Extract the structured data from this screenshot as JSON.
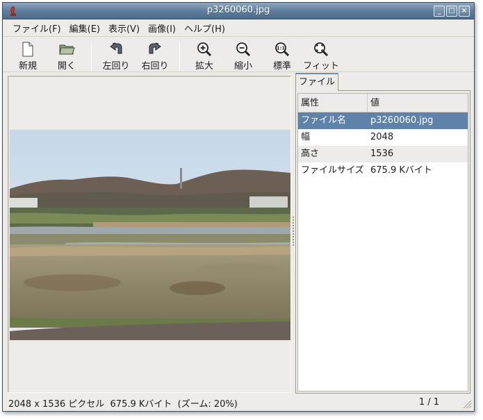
{
  "window": {
    "title": "p3260060.jpg",
    "controls": [
      "_",
      "□",
      "×"
    ]
  },
  "menu": [
    {
      "label": "ファイル(F)"
    },
    {
      "label": "編集(E)"
    },
    {
      "label": "表示(V)"
    },
    {
      "label": "画像(I)"
    },
    {
      "label": "ヘルプ(H)"
    }
  ],
  "toolbar": {
    "new_label": "新規",
    "open_label": "開く",
    "rotate_left_label": "左回り",
    "rotate_right_label": "右回り",
    "zoom_in_label": "拡大",
    "zoom_out_label": "縮小",
    "zoom_normal_label": "標準",
    "zoom_fit_label": "フィット"
  },
  "properties": {
    "tab_label": "ファイル",
    "header_attr": "属性",
    "header_value": "値",
    "rows": [
      {
        "attr": "ファイル名",
        "value": "p3260060.jpg"
      },
      {
        "attr": "幅",
        "value": "2048"
      },
      {
        "attr": "高さ",
        "value": "1536"
      },
      {
        "attr": "ファイルサイズ",
        "value": "675.9 Kバイト"
      }
    ]
  },
  "status": {
    "info": "2048 x 1536 ピクセル  675.9 Kバイト  (ズーム: 20%)",
    "page": "1 / 1"
  },
  "colors": {
    "titlebar": "#5f7e9d",
    "selection": "#5e82a8",
    "window_bg": "#edebe8"
  },
  "icons": [
    "app-icon",
    "new-document-icon",
    "open-folder-icon",
    "rotate-left-icon",
    "rotate-right-icon",
    "zoom-in-icon",
    "zoom-out-icon",
    "zoom-normal-icon",
    "zoom-fit-icon"
  ]
}
